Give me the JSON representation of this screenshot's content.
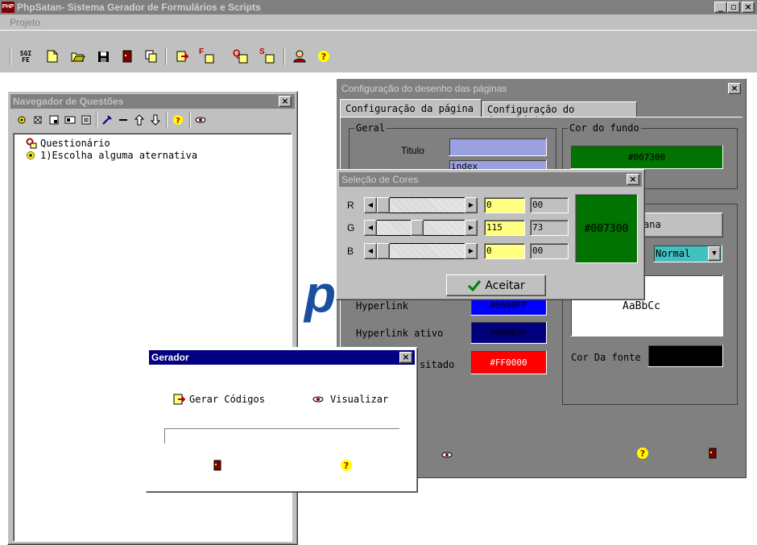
{
  "app": {
    "title": "PhpSatan- Sistema Gerador de Formulários e Scripts",
    "menu": [
      "Projeto"
    ],
    "toolbar_icons": [
      "sgi-fe-icon",
      "new-file-icon",
      "open-folder-icon",
      "save-icon",
      "exit-door-icon",
      "copy-pages-icon",
      "generate-icon",
      "form-f-icon",
      "query-q-icon",
      "script-s-icon",
      "users-icon",
      "help-icon"
    ],
    "title_buttons": [
      "_",
      "▫",
      "×"
    ],
    "toolbar_sgi": "SGI\nFE",
    "icon_letters": {
      "form": "F",
      "query": "Q",
      "script": "S"
    }
  },
  "navegador": {
    "title": "Navegador de Questões",
    "tree": [
      {
        "label": "Questionário",
        "icon": "query-icon"
      },
      {
        "label": "1)Escolha alguma aternativa",
        "icon": "question-bullet-icon"
      }
    ]
  },
  "config": {
    "title": "Configuração do desenho das páginas",
    "tabs": [
      "Configuração da página",
      "Configuração do formulário"
    ],
    "geral_label": "Geral",
    "titulo_label": "Titulo",
    "titulo_value": "",
    "index_value": "index",
    "cor_fundo_label": "Cor do fundo",
    "cor_fundo_value": "#007300",
    "janela_btn": "ana",
    "font_style_value": "Normal",
    "preview_text": "AaBbCc",
    "hyperlink_label": "Hyperlink",
    "hyperlink_value": "#0000FF",
    "hyperlink_ativo_label": "Hyperlink ativo",
    "hyperlink_ativo_value": "#00007F",
    "visitado_label": "sitado",
    "visitado_value": "#FF0000",
    "cor_fonte_label": "Cor Da fonte",
    "watermark": "p",
    "colors": {
      "fundo": "#007300",
      "hyperlink": "#0000FF",
      "ativo": "#00007F",
      "visitado": "#FF0000",
      "fonte": "#000000"
    }
  },
  "cores": {
    "title": "Seleção de Cores",
    "rows": [
      {
        "label": "R",
        "value": "0",
        "hex": "00",
        "level": 0
      },
      {
        "label": "G",
        "value": "115",
        "hex": "73",
        "level": 0.45
      },
      {
        "label": "B",
        "value": "0",
        "hex": "00",
        "level": 0
      }
    ],
    "preview_value": "#007300",
    "aceitar": "Aceitar"
  },
  "gerador": {
    "title": "Gerador",
    "gerar": "Gerar Códigos",
    "visualizar": "Visualizar"
  }
}
